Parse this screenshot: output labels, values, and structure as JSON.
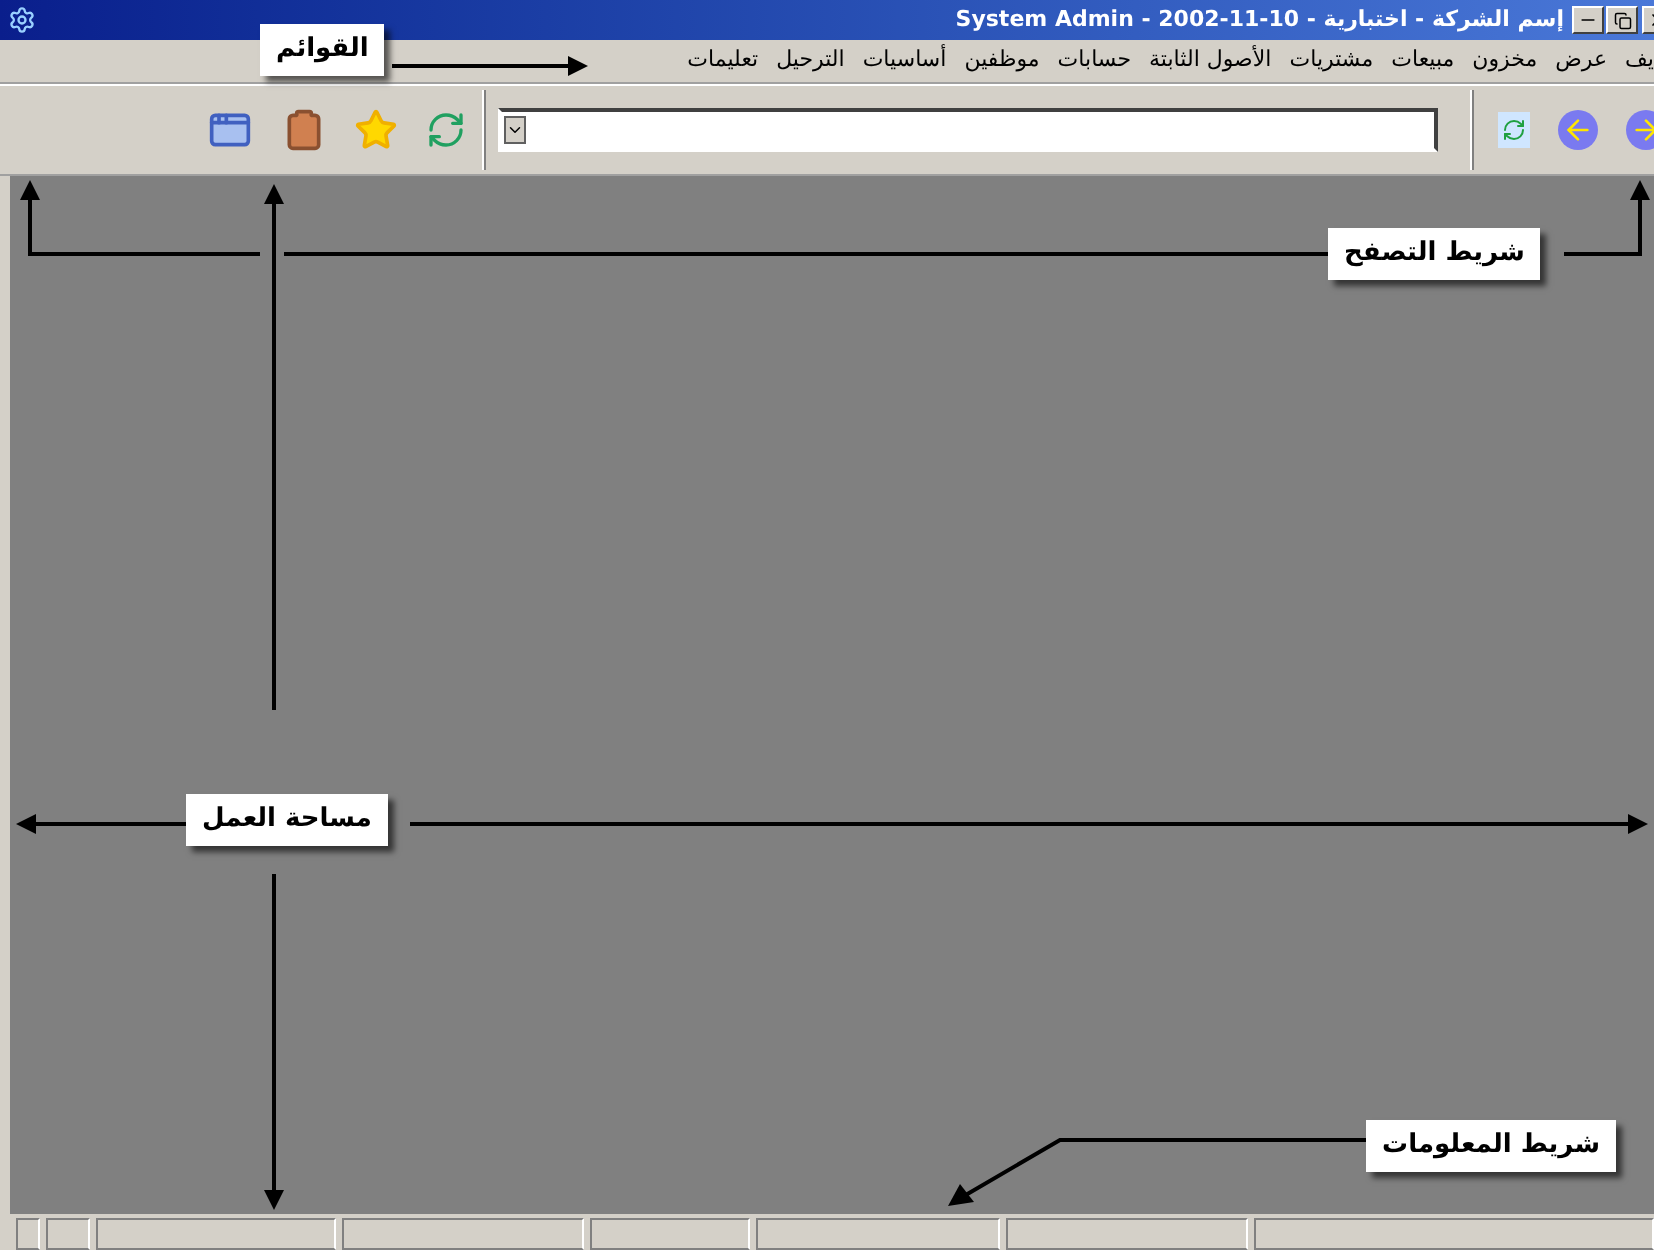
{
  "window": {
    "title": "إسم الشركة - اختبارية - 10-11-2002 - System Admin"
  },
  "menu": {
    "items": [
      "يف",
      "عرض",
      "مخزون",
      "مبيعات",
      "مشتريات",
      "الأصول الثابتة",
      "حسابات",
      "موظفين",
      "أساسيات",
      "الترحيل",
      "تعليمات"
    ]
  },
  "annotations": [
    {
      "text": "القوائم"
    },
    {
      "text": "شريط التصفح"
    },
    {
      "text": "مساحة العمل"
    },
    {
      "text": "شريط المعلومات"
    }
  ]
}
